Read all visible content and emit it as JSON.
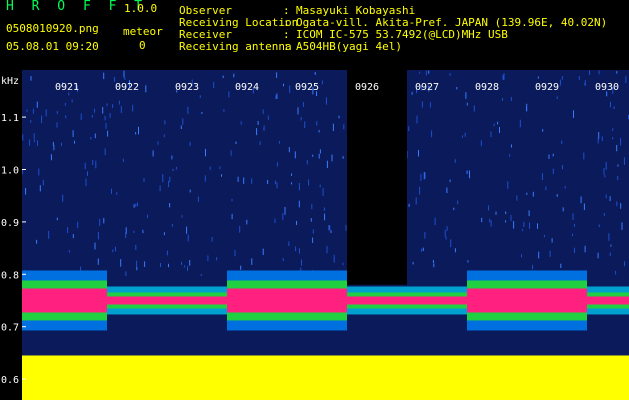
{
  "app": {
    "title": "H R O F F T",
    "version": "1.0.0"
  },
  "file": {
    "name": "0508010920.png",
    "timestamp": "05.08.01 09:20"
  },
  "meteor": {
    "label": "meteor",
    "count": "0"
  },
  "info": {
    "separator": ":",
    "rows": [
      {
        "label": "Observer",
        "value": "Masayuki Kobayashi"
      },
      {
        "label": "Receiving Location",
        "value": "Ogata-vill. Akita-Pref. JAPAN (139.96E, 40.02N)"
      },
      {
        "label": "Receiver",
        "value": "ICOM IC-575 53.7492(@LCD)MHz USB"
      },
      {
        "label": "Receiving antenna",
        "value": "A504HB(yagi 4el)"
      }
    ]
  },
  "colors": {
    "header_text": "#ffff00",
    "header_green": "#00ff55",
    "tick_labels": "#ffffff",
    "background": "#000000"
  },
  "chart_data": {
    "type": "heatmap",
    "ylabel": "kHz",
    "y_ticks": [
      {
        "label": "1.1",
        "value": 1.1
      },
      {
        "label": "1.0",
        "value": 1.0
      },
      {
        "label": "0.9",
        "value": 0.9
      },
      {
        "label": "0.8",
        "value": 0.8
      },
      {
        "label": "0.7",
        "value": 0.7
      },
      {
        "label": "0.6",
        "value": 0.6
      }
    ],
    "ylim": [
      0.56,
      1.19
    ],
    "x_ticks": [
      "0921",
      "0922",
      "0923",
      "0924",
      "0925",
      "0926",
      "0927",
      "0928",
      "0929",
      "0930"
    ],
    "carrier_khz": 0.75,
    "quiet_intervals": [
      [
        "0926",
        "0927"
      ]
    ],
    "strong_echo_intervals": [
      [
        "0920",
        "0922"
      ],
      [
        "0924",
        "0926"
      ],
      [
        "0928",
        "0930"
      ]
    ]
  }
}
